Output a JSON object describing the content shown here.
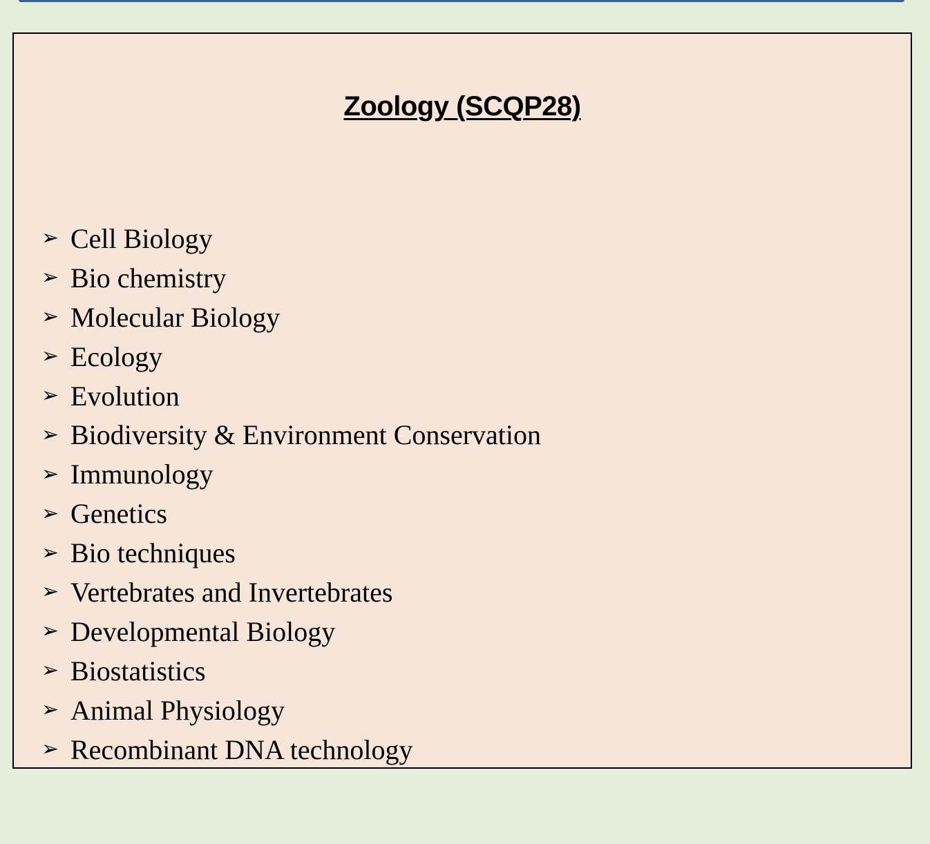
{
  "page": {
    "title": "Zoology (SCQP28)",
    "colors": {
      "background": "#e3eedb",
      "panel": "#f7e5d9",
      "top_bar": "#3d5f97",
      "border": "#000000"
    },
    "bullet_icon": "arrow-bullet-icon"
  },
  "topics": [
    "Cell Biology",
    "Bio chemistry",
    "Molecular Biology",
    "Ecology",
    "Evolution",
    "Biodiversity & Environment Conservation",
    "Immunology",
    "Genetics",
    "Bio techniques",
    "Vertebrates and Invertebrates",
    "Developmental Biology",
    "Biostatistics",
    "Animal Physiology",
    "Recombinant DNA technology"
  ]
}
